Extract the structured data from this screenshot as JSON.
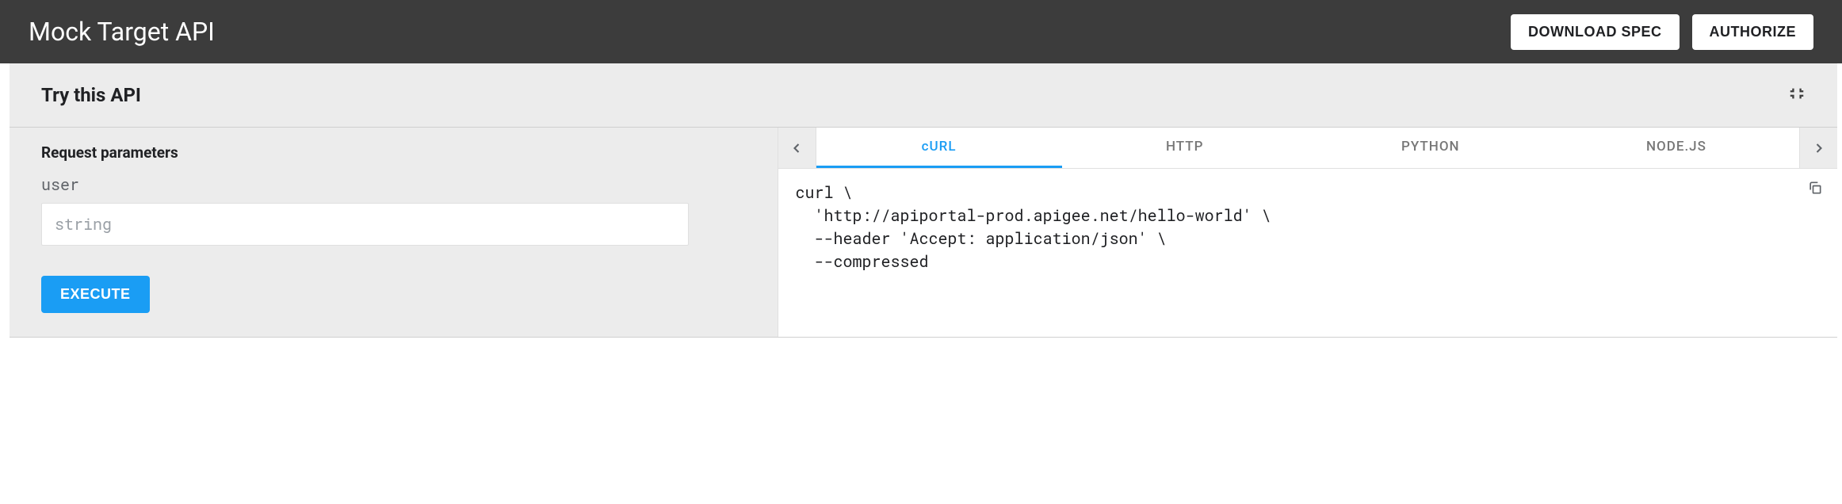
{
  "topbar": {
    "title": "Mock Target API",
    "download": "DOWNLOAD SPEC",
    "authorize": "AUTHORIZE"
  },
  "panel": {
    "title": "Try this API",
    "request_params_label": "Request parameters",
    "field": {
      "name": "user",
      "placeholder": "string",
      "value": ""
    },
    "execute_label": "EXECUTE"
  },
  "tabs": {
    "items": [
      "cURL",
      "HTTP",
      "PYTHON",
      "NODE.JS"
    ],
    "active_index": 0
  },
  "code": {
    "content": "curl \\\n  'http://apiportal-prod.apigee.net/hello-world' \\\n  --header 'Accept: application/json' \\\n  --compressed"
  }
}
